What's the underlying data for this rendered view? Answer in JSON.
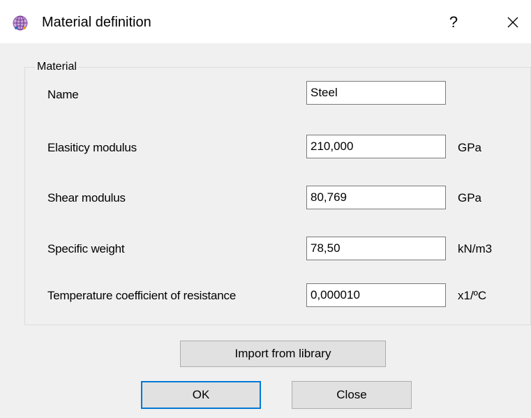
{
  "window": {
    "title": "Material definition",
    "help_label": "?",
    "icon": "globe-app-icon"
  },
  "group": {
    "legend": "Material"
  },
  "fields": [
    {
      "label": "Name",
      "value": "Steel",
      "unit": ""
    },
    {
      "label": "Elasiticy modulus",
      "value": "210,000",
      "unit": "GPa"
    },
    {
      "label": "Shear modulus",
      "value": "80,769",
      "unit": "GPa"
    },
    {
      "label": "Specific weight",
      "value": "78,50",
      "unit": "kN/m3"
    },
    {
      "label": "Temperature coefficient of resistance",
      "value": "0,000010",
      "unit": "x1/ºC"
    }
  ],
  "buttons": {
    "import_label": "Import from library",
    "ok_label": "OK",
    "close_label": "Close"
  },
  "colors": {
    "background": "#f0f0f0",
    "titlebar": "#ffffff",
    "default_button_border": "#0078d7"
  }
}
